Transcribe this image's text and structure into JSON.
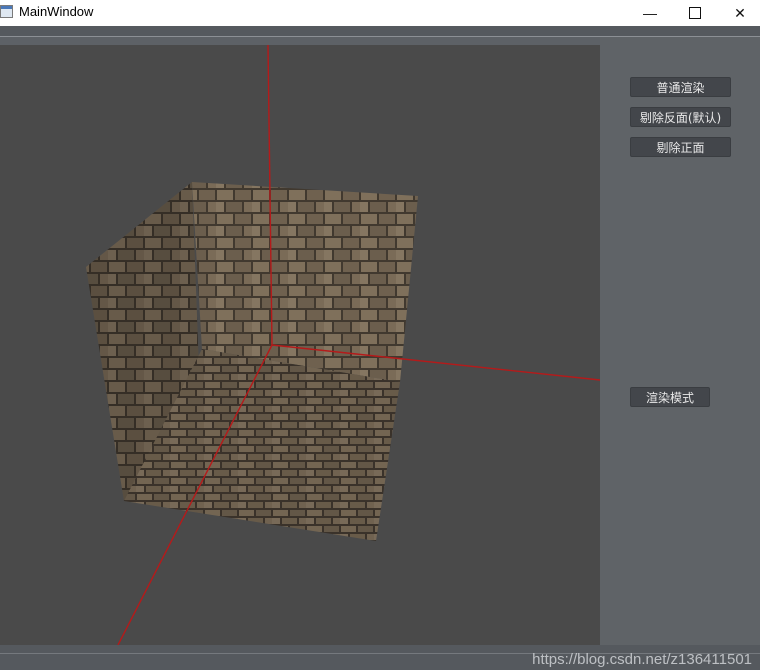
{
  "window": {
    "title": "MainWindow"
  },
  "controls": {
    "normal_render_label": "普通渲染",
    "cull_back_label": "剔除反面(默认)",
    "cull_front_label": "剔除正面",
    "render_mode_label": "渲染模式"
  },
  "watermark": "https://blog.csdn.net/z136411501",
  "colors": {
    "viewport_bg": "#4a4a4a",
    "panel_bg": "#5f6367",
    "axis": "#b01818",
    "brick": "#7a6a55",
    "mortar": "#40382e"
  },
  "icons": [
    "app-icon",
    "minimize-icon",
    "maximize-icon",
    "close-icon"
  ]
}
